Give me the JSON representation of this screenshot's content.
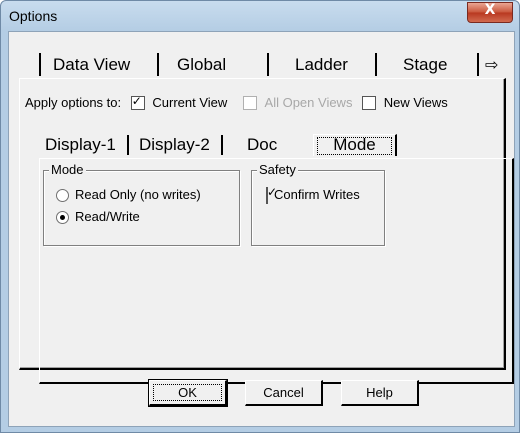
{
  "window": {
    "title": "Options",
    "close_label": "X"
  },
  "outer_tabs": {
    "items": [
      "Data View",
      "Global",
      "Ladder",
      "Stage"
    ],
    "scroll_icon": "⇨",
    "active": "Data View"
  },
  "apply": {
    "label": "Apply options to:",
    "current_view": {
      "label": "Current View",
      "checked": true
    },
    "all_open_views": {
      "label": "All Open Views",
      "checked": false,
      "disabled": true
    },
    "new_views": {
      "label": "New Views",
      "checked": false
    }
  },
  "inner_tabs": {
    "items": [
      "Display-1",
      "Display-2",
      "Doc",
      "Mode"
    ],
    "active": "Mode"
  },
  "mode_group": {
    "label": "Mode",
    "read_only": {
      "label": "Read Only (no writes)",
      "selected": false
    },
    "read_write": {
      "label": "Read/Write",
      "selected": true
    }
  },
  "safety_group": {
    "label": "Safety",
    "confirm_writes": {
      "label": "Confirm Writes",
      "checked": true
    }
  },
  "buttons": {
    "ok": "OK",
    "cancel": "Cancel",
    "help": "Help"
  }
}
